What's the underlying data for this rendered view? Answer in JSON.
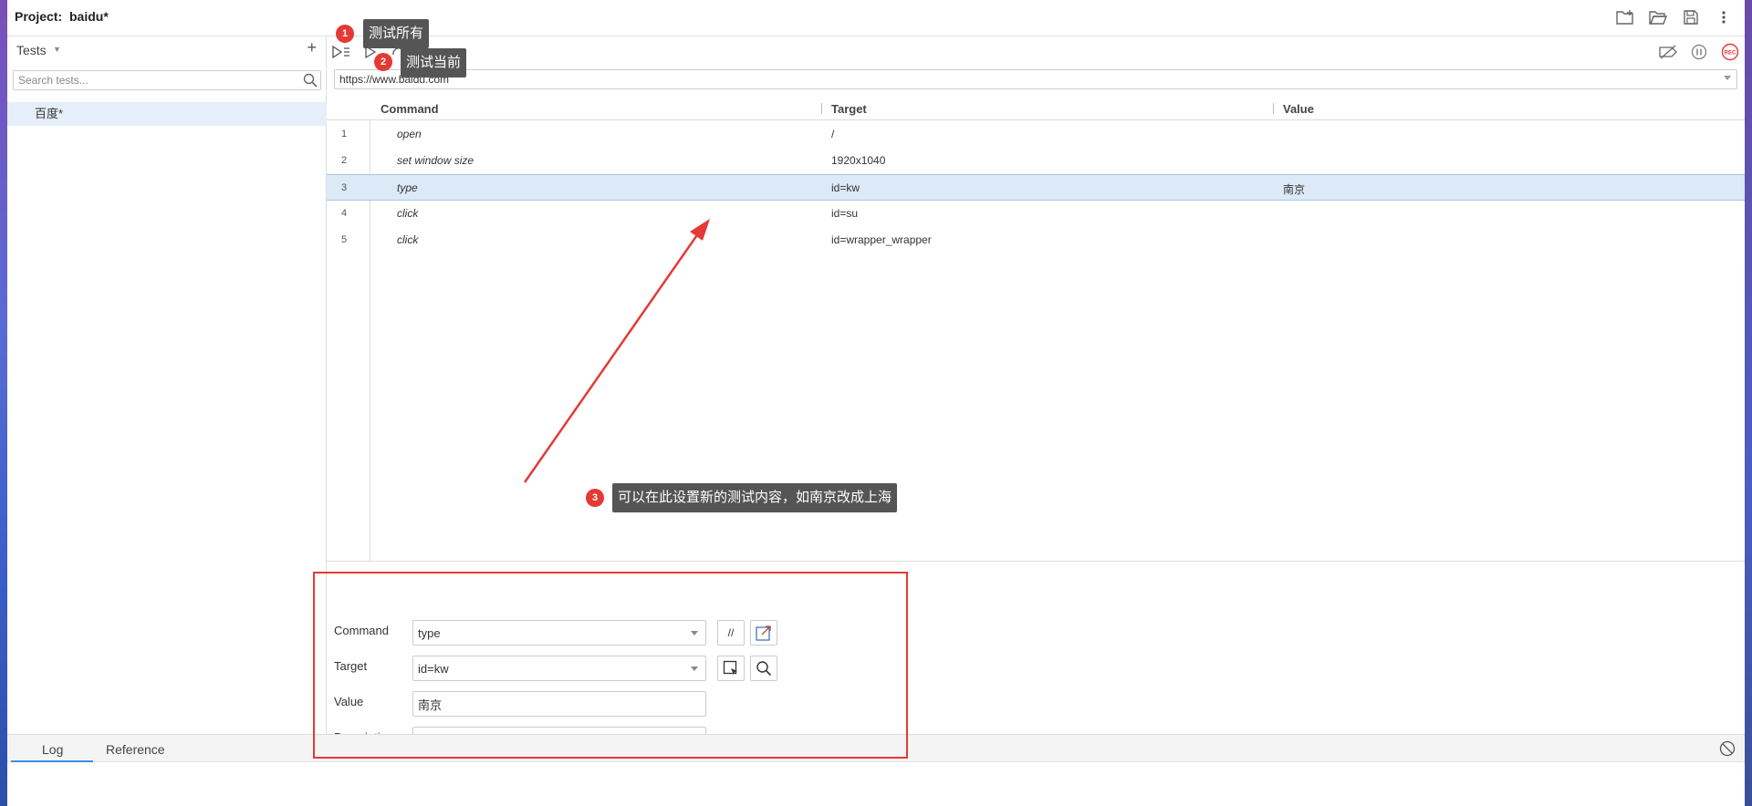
{
  "header": {
    "project_label": "Project:",
    "project_name": "baidu*"
  },
  "sidebar": {
    "title": "Tests",
    "search_placeholder": "Search tests...",
    "tests": [
      {
        "label": "百度*"
      }
    ]
  },
  "main": {
    "url": "https://www.baidu.com",
    "columns": {
      "command": "Command",
      "target": "Target",
      "value": "Value"
    },
    "rows": [
      {
        "num": "1",
        "command": "open",
        "target": "/",
        "value": ""
      },
      {
        "num": "2",
        "command": "set window size",
        "target": "1920x1040",
        "value": ""
      },
      {
        "num": "3",
        "command": "type",
        "target": "id=kw",
        "value": "南京"
      },
      {
        "num": "4",
        "command": "click",
        "target": "id=su",
        "value": ""
      },
      {
        "num": "5",
        "command": "click",
        "target": "id=wrapper_wrapper",
        "value": ""
      }
    ]
  },
  "editor": {
    "command_label": "Command",
    "command_value": "type",
    "comment_btn": "//",
    "target_label": "Target",
    "target_value": "id=kw",
    "value_label": "Value",
    "value_value": "南京",
    "description_label": "Description",
    "description_value": ""
  },
  "bottom": {
    "tab_log": "Log",
    "tab_reference": "Reference"
  },
  "annotations": {
    "a1": {
      "num": "1",
      "text": "测试所有"
    },
    "a2": {
      "num": "2",
      "text": "测试当前"
    },
    "a3": {
      "num": "3",
      "text": "可以在此设置新的测试内容，如南京改成上海"
    }
  },
  "colors": {
    "accent": "#e53935",
    "selected_row": "#dce9f7",
    "tab_underline": "#3c8ee8"
  }
}
